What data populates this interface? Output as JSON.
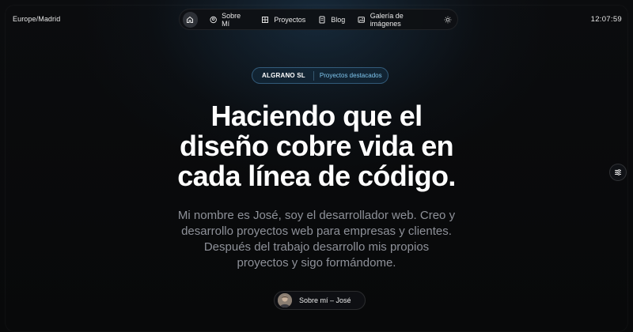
{
  "header": {
    "timezone": "Europe/Madrid",
    "clock": "12:07:59"
  },
  "nav": {
    "home_icon": "home-icon",
    "items": [
      {
        "label": "Sobre Mí",
        "icon": "user-circle-icon"
      },
      {
        "label": "Proyectos",
        "icon": "grid-icon"
      },
      {
        "label": "Blog",
        "icon": "document-icon"
      },
      {
        "label": "Galería de imágenes",
        "icon": "image-icon"
      }
    ],
    "theme_icon": "sun-icon"
  },
  "badge": {
    "brand": "ALGRANO SL",
    "text": "Proyectos destacados"
  },
  "hero": {
    "headline": [
      "Haciendo que el",
      "diseño cobre vida en",
      "cada línea de código."
    ],
    "intro": [
      "Mi nombre es José, soy el desarrollador web. Creo y",
      "desarrollo proyectos web para empresas y clientes.",
      "Después del trabajo desarrollo mis propios",
      "proyectos y sigo formándome."
    ],
    "about_button": "Sobre mí – José"
  },
  "side_toggle_icon": "sliders-icon",
  "colors": {
    "accent": "#7fc6ee",
    "background": "#0a0a0b",
    "muted_text": "#8e9199"
  }
}
